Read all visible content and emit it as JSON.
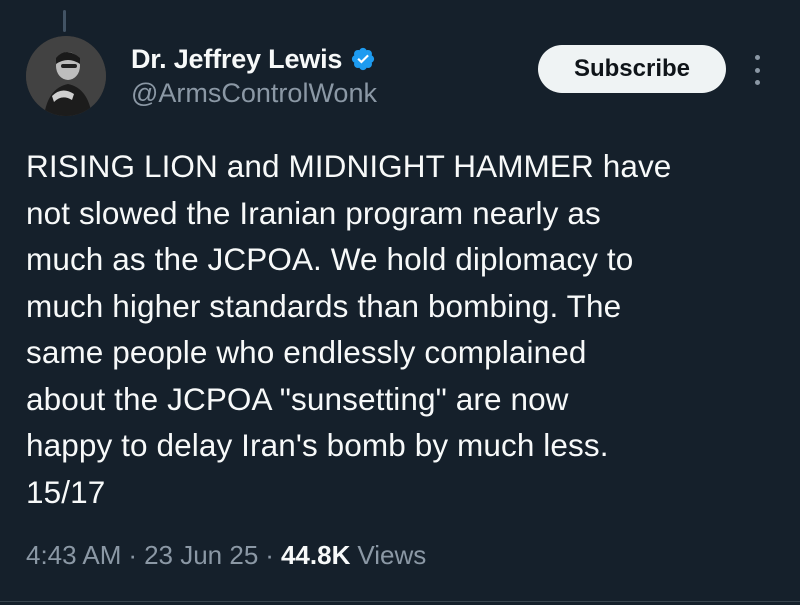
{
  "author": {
    "display_name": "Dr. Jeffrey Lewis",
    "handle": "@ArmsControlWonk",
    "verified": true
  },
  "actions": {
    "subscribe_label": "Subscribe",
    "more_icon": "more-vertical-icon"
  },
  "tweet": {
    "text": "RISING LION and MIDNIGHT HAMMER have\nnot slowed the Iranian program nearly as\nmuch as the JCPOA. We hold diplomacy to\nmuch higher standards than bombing. The\nsame people who endlessly complained\nabout the JCPOA \"sunsetting\" are now\nhappy to delay Iran's bomb by much less.\n15/17",
    "time": "4:43 AM",
    "separator": "·",
    "date": "23 Jun 25",
    "views_count": "44.8K",
    "views_label": "Views"
  },
  "colors": {
    "background": "#15202b",
    "text_primary": "#f7f9f9",
    "text_secondary": "#8b98a5",
    "verified_badge": "#1d9bf0",
    "subscribe_bg": "#eff3f4"
  }
}
